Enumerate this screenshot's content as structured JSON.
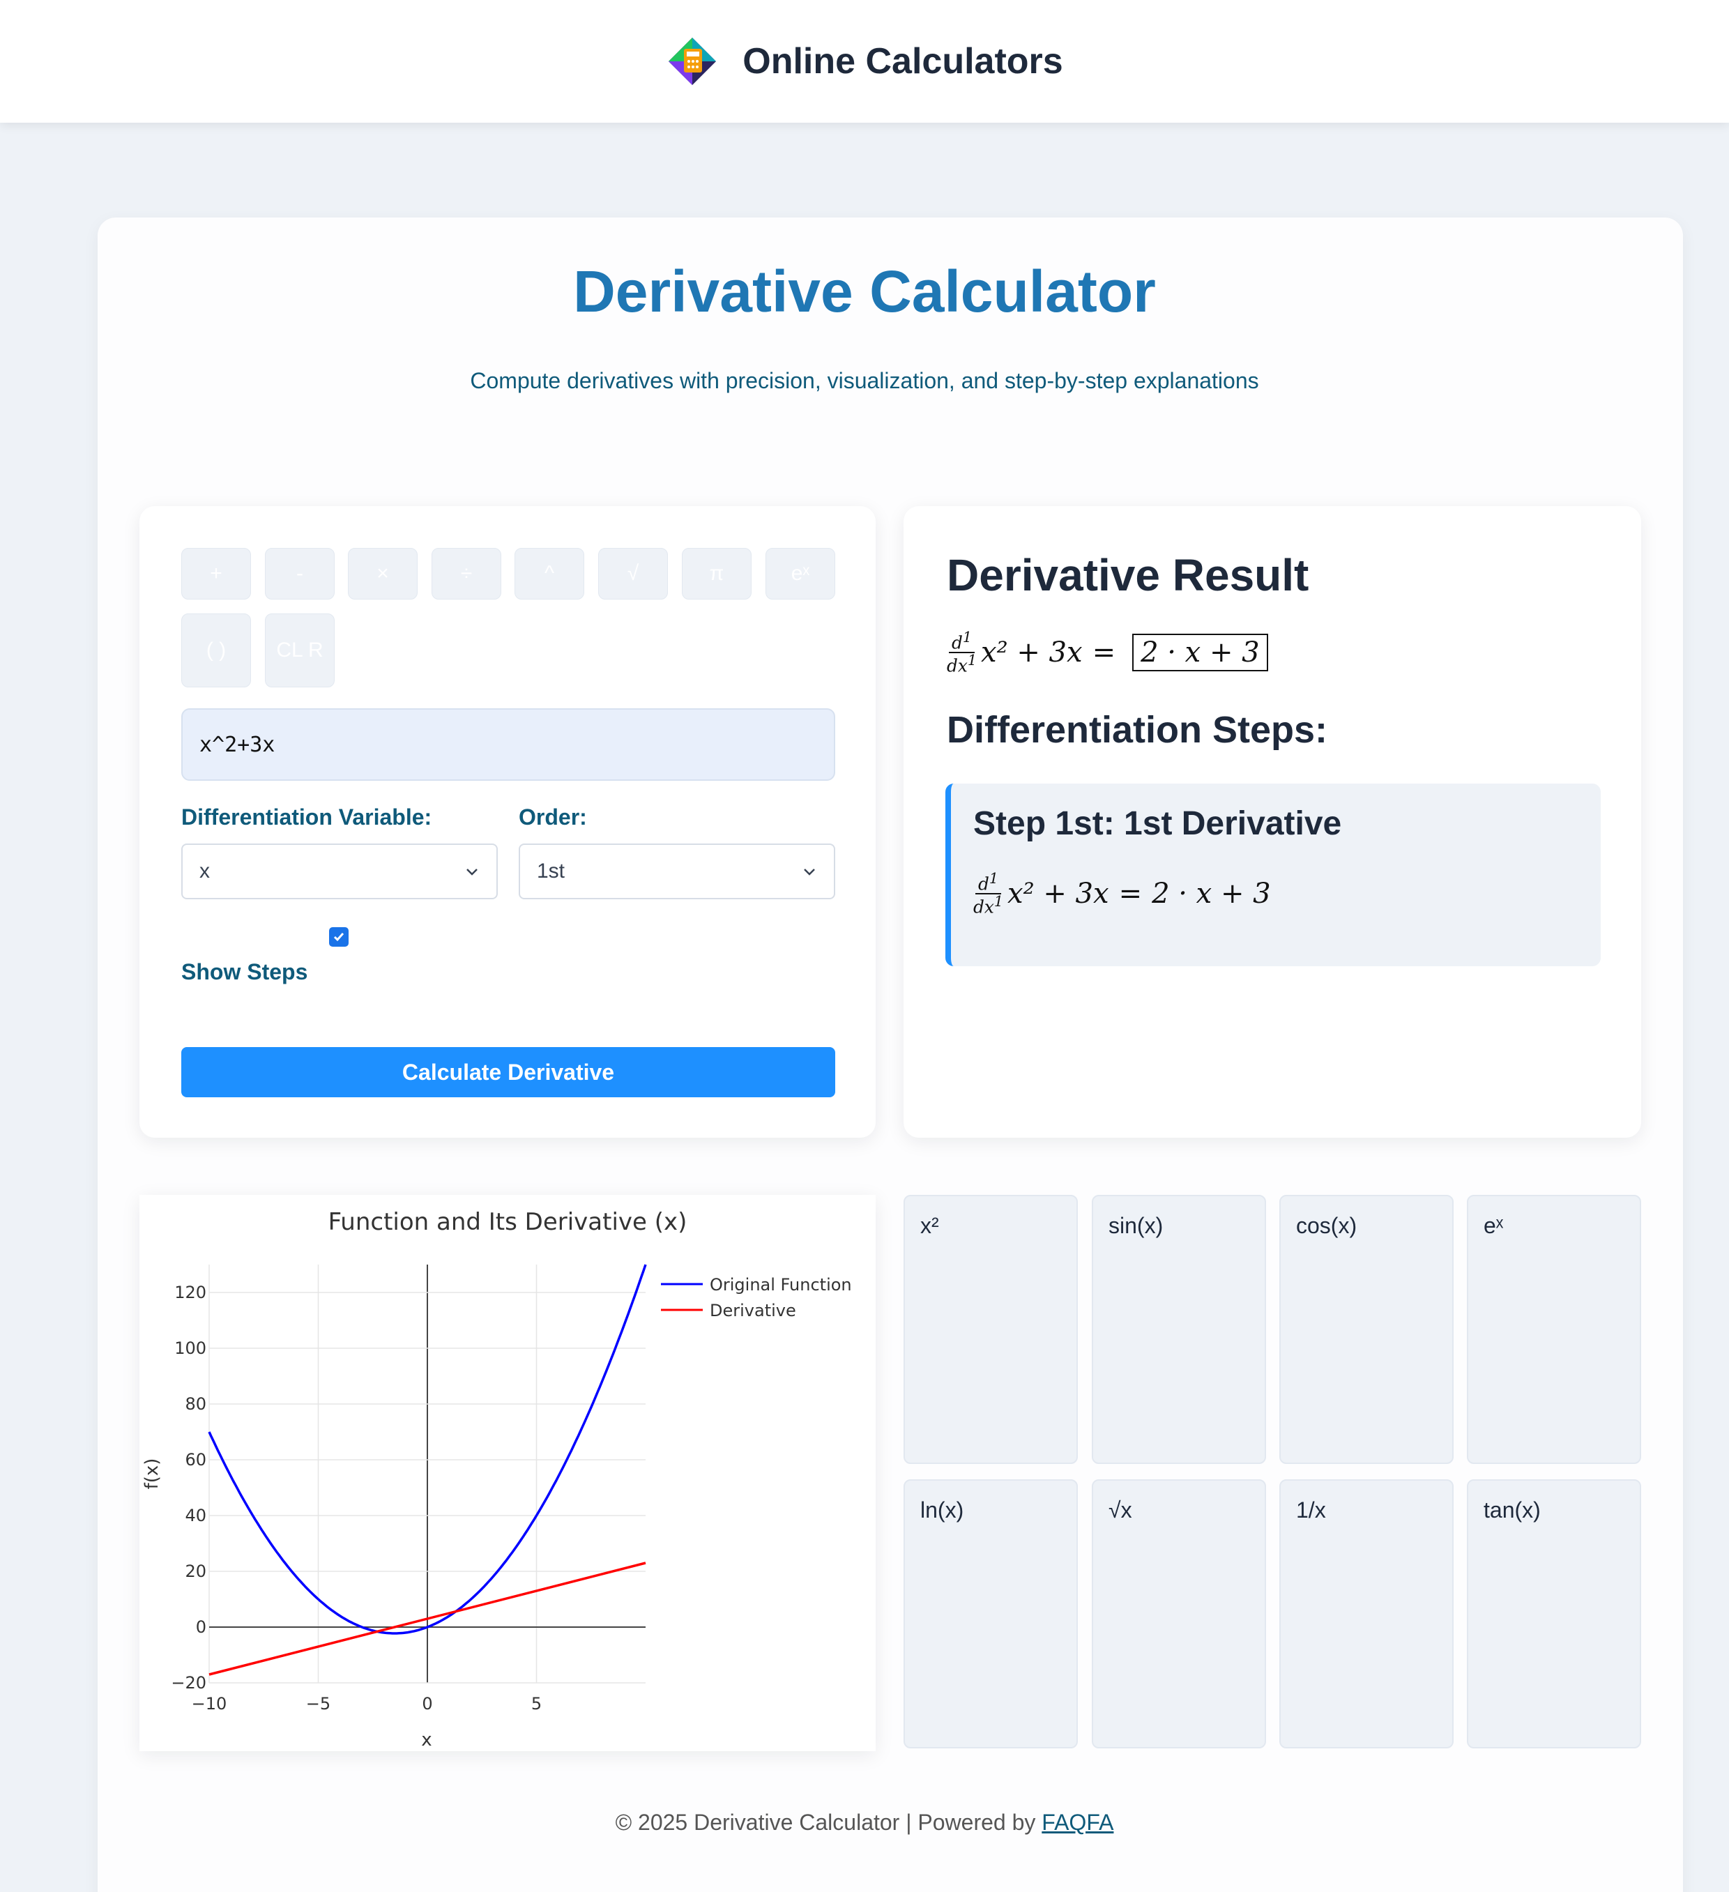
{
  "header": {
    "site_name": "Online Calculators",
    "logo_icon": "calculator-logo-icon"
  },
  "page": {
    "title": "Derivative Calculator",
    "subtitle": "Compute derivatives with precision, visualization, and step-by-step explanations"
  },
  "keypad": {
    "keys": [
      "+",
      "-",
      "×",
      "÷",
      "^",
      "√",
      "π",
      "eˣ",
      "( )",
      "CL R"
    ]
  },
  "form": {
    "expression_value": "x^2+3x",
    "variable_label": "Differentiation Variable:",
    "variable_value": "x",
    "order_label": "Order:",
    "order_value": "1st",
    "show_steps_label": "Show Steps",
    "show_steps_checked": true,
    "calculate_label": "Calculate Derivative"
  },
  "result": {
    "title": "Derivative Result",
    "derivative_order_sup": "1",
    "expression": "x² + 3x",
    "answer": "2 · x + 3",
    "steps_title": "Differentiation Steps:",
    "steps": [
      {
        "title": "Step 1st: 1st Derivative",
        "lhs": "x² + 3x",
        "rhs": "2 · x + 3"
      }
    ]
  },
  "chart_data": {
    "type": "line",
    "title": "Function and Its Derivative (x)",
    "xlabel": "x",
    "ylabel": "f(x)",
    "xlim": [
      -10,
      10
    ],
    "ylim": [
      -20,
      130
    ],
    "x_ticks": [
      "−10",
      "−5",
      "0",
      "5"
    ],
    "y_ticks": [
      "−20",
      "0",
      "20",
      "40",
      "60",
      "80",
      "100",
      "120"
    ],
    "legend": "top-right",
    "series": [
      {
        "name": "Original Function",
        "color": "#0000ff",
        "expression": "x^2+3x",
        "x": [
          -10,
          -8,
          -6,
          -4,
          -2,
          -1.5,
          0,
          2,
          4,
          6,
          8,
          10
        ],
        "y": [
          70,
          40,
          18,
          4,
          -2,
          -2.25,
          0,
          10,
          28,
          54,
          88,
          130
        ]
      },
      {
        "name": "Derivative",
        "color": "#ff0000",
        "expression": "2x+3",
        "x": [
          -10,
          10
        ],
        "y": [
          -17,
          23
        ]
      }
    ]
  },
  "function_tiles": [
    "x²",
    "sin(x)",
    "cos(x)",
    "eˣ",
    "ln(x)",
    "√x",
    "1/x",
    "tan(x)"
  ],
  "footer": {
    "text": "© 2025 Derivative Calculator | Powered by",
    "link": "FAQFA"
  }
}
